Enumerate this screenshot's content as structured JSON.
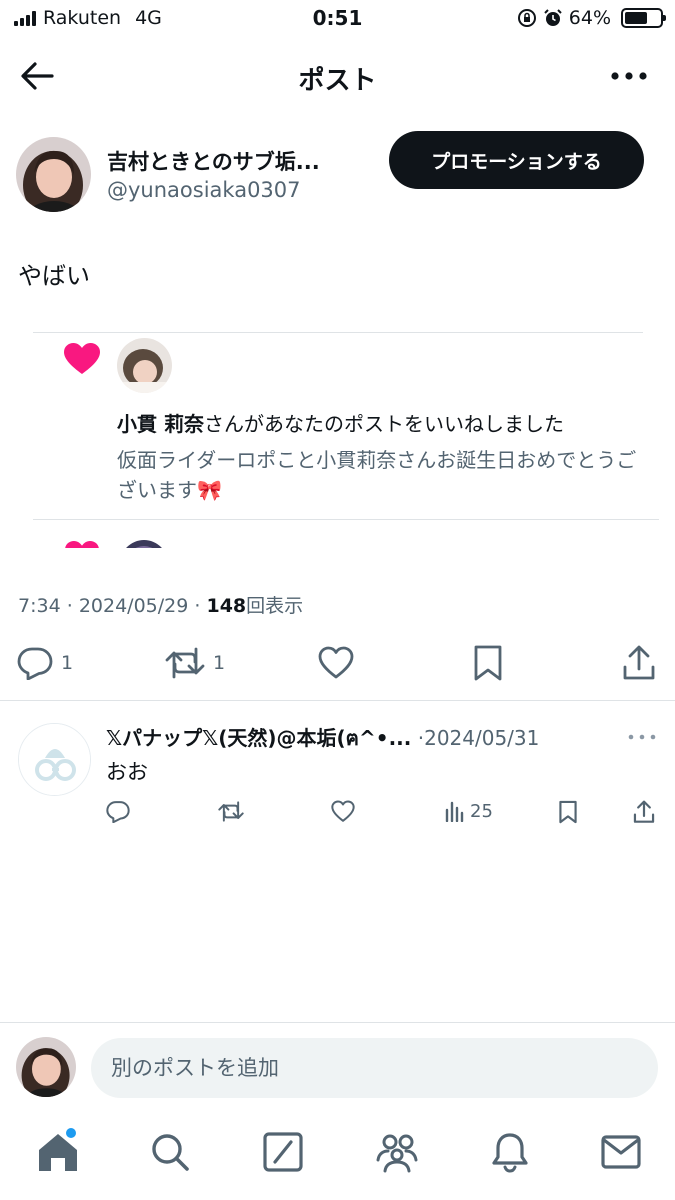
{
  "status_bar": {
    "carrier": "Rakuten",
    "network": "4G",
    "time": "0:51",
    "battery_percent": "64%",
    "battery_level": 0.64
  },
  "nav": {
    "title": "ポスト",
    "back_icon": "arrow-left-icon",
    "more_icon": "more-horizontal-icon"
  },
  "post": {
    "author_name": "吉村ときとのサブ垢...",
    "author_handle": "@yunaosiaka0307",
    "promote_label": "プロモーションする",
    "text": "やばい",
    "time": "7:34",
    "date": "2024/05/29",
    "views_count": "148",
    "views_label": "回表示",
    "meta_separator": "·",
    "reply_count": "1",
    "repost_count": "1"
  },
  "like_notification": {
    "icon": "heart-icon",
    "liker_name": "小貫 莉奈",
    "action_text": "さんがあなたのポストをいいねしました",
    "quote_text": "仮面ライダーロポこと小貫莉奈さんお誕生日おめでとうございます🎀"
  },
  "reply": {
    "display_name": "𝕏パナップ𝕏(天然)@本垢(ฅ^•...",
    "separator": "·",
    "date": "2024/05/31",
    "text": "おお",
    "views_count": "25"
  },
  "composer": {
    "placeholder": "別のポストを追加"
  },
  "tab_bar": {
    "items": [
      "home-icon",
      "search-icon",
      "compose-icon",
      "communities-icon",
      "notifications-icon",
      "messages-icon"
    ]
  },
  "colors": {
    "text": "#0f1419",
    "secondary": "#536471",
    "like": "#f91880",
    "accent": "#1d9bf0",
    "divider": "#dfe3e6"
  }
}
